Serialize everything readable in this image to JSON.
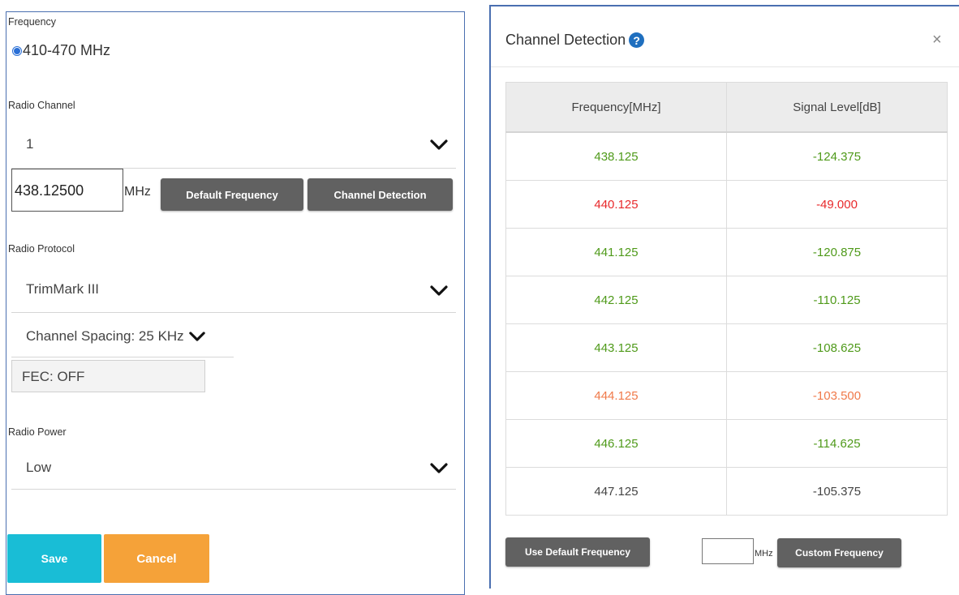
{
  "settings": {
    "frequency_label": "Frequency",
    "frequency_option": "410-470 MHz",
    "radio_channel_label": "Radio Channel",
    "radio_channel_value": "1",
    "frequency_value": "438.12500",
    "mhz_unit": "MHz",
    "default_frequency_button": "Default Frequency",
    "channel_detection_button": "Channel Detection",
    "radio_protocol_label": "Radio Protocol",
    "radio_protocol_value": "TrimMark III",
    "channel_spacing": "Channel Spacing: 25 KHz",
    "fec": "FEC: OFF",
    "radio_power_label": "Radio Power",
    "radio_power_value": "Low",
    "save_button": "Save",
    "cancel_button": "Cancel"
  },
  "dialog": {
    "title": "Channel Detection",
    "help_icon": "?",
    "close_icon": "×",
    "columns": [
      "Frequency[MHz]",
      "Signal Level[dB]"
    ],
    "rows": [
      {
        "frequency": "438.125",
        "level": "-124.375",
        "color": "#4f9a1a"
      },
      {
        "frequency": "440.125",
        "level": "-49.000",
        "color": "#e8292b"
      },
      {
        "frequency": "441.125",
        "level": "-120.875",
        "color": "#4f9a1a"
      },
      {
        "frequency": "442.125",
        "level": "-110.125",
        "color": "#4f9a1a"
      },
      {
        "frequency": "443.125",
        "level": "-108.625",
        "color": "#4f9a1a"
      },
      {
        "frequency": "444.125",
        "level": "-103.500",
        "color": "#f07a4a"
      },
      {
        "frequency": "446.125",
        "level": "-114.625",
        "color": "#4f9a1a"
      },
      {
        "frequency": "447.125",
        "level": "-105.375",
        "color": "#444444"
      }
    ],
    "use_default_button": "Use Default Frequency",
    "custom_mhz_unit": "MHz",
    "custom_frequency_button": "Custom Frequency"
  }
}
